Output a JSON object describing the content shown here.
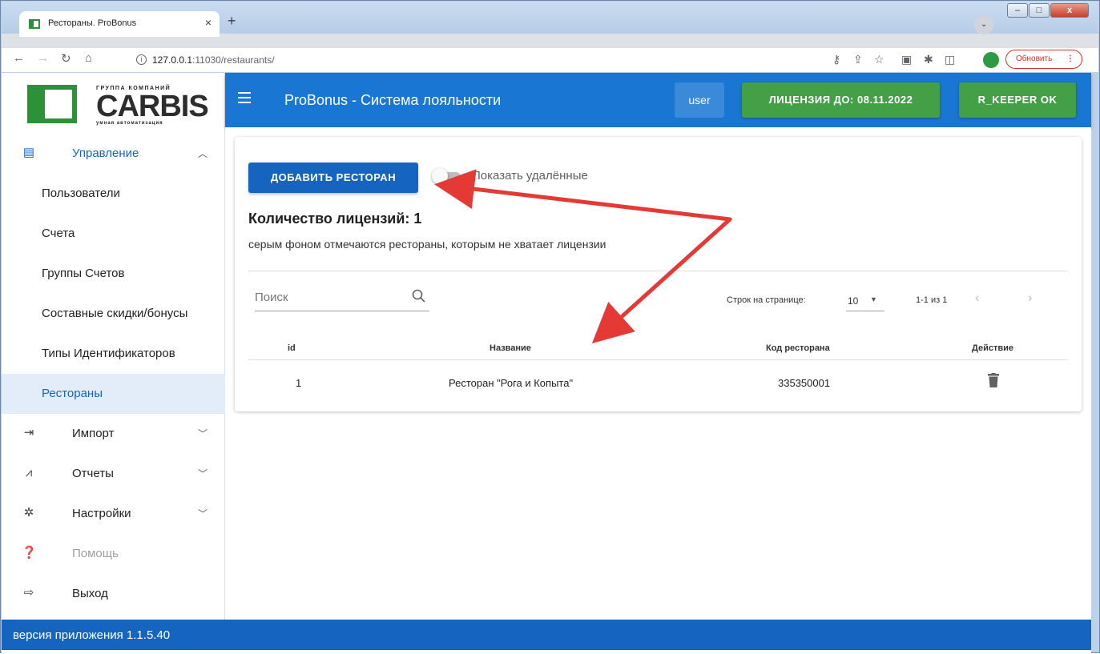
{
  "browser": {
    "tab_title": "Рестораны. ProBonus",
    "tab_close": "×",
    "new_tab": "+",
    "address_host": "127.0.0.1",
    "address_path": ":11030/restaurants/",
    "update_label": "Обновить",
    "update_menu": "⋮",
    "window_min": "–",
    "window_max": "□",
    "window_close": "x"
  },
  "logo": {
    "top_text": "ГРУППА КОМПАНИЙ",
    "main_text": "CARBIS",
    "sub_text": "умная автоматизация"
  },
  "appbar": {
    "title": "ProBonus - Система лояльности",
    "user_label": "user",
    "license_label": "ЛИЦЕНЗИЯ ДО: 08.11.2022",
    "keeper_label": "R_KEEPER OK"
  },
  "sidebar": {
    "group_label": "Управление",
    "items": [
      {
        "label": "Пользователи"
      },
      {
        "label": "Счета"
      },
      {
        "label": "Группы Счетов"
      },
      {
        "label": "Составные скидки/бонусы"
      },
      {
        "label": "Типы Идентификаторов"
      },
      {
        "label": "Рестораны"
      }
    ],
    "import_label": "Импорт",
    "reports_label": "Отчеты",
    "settings_label": "Настройки",
    "help_label": "Помощь",
    "exit_label": "Выход"
  },
  "main": {
    "add_button": "ДОБАВИТЬ РЕСТОРАН",
    "show_deleted_label": "Показать удалённые",
    "license_count": "Количество лицензий: 1",
    "license_note": "серым фоном отмечаются рестораны, которым не хватает лицензии",
    "search_placeholder": "Поиск",
    "rows_per_page_label": "Строк на странице:",
    "rows_per_page_value": "10",
    "range_label": "1-1 из 1",
    "prev": "‹",
    "next": "›",
    "columns": {
      "id": "id",
      "name": "Название",
      "code": "Код ресторана",
      "action": "Действие"
    },
    "rows": [
      {
        "id": "1",
        "name": "Ресторан \"Рога и Копыта\"",
        "code": "335350001"
      }
    ]
  },
  "footer": {
    "version": "версия приложения 1.1.5.40"
  },
  "colors": {
    "primary": "#1976d2",
    "primary_dark": "#1565c0",
    "success": "#43a047",
    "arrow": "#e53935",
    "brand_green": "#2d9137"
  }
}
